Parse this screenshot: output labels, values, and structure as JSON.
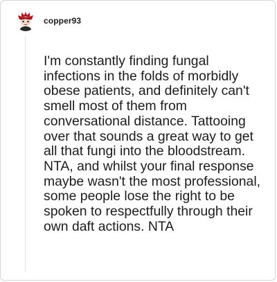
{
  "comment": {
    "username": "copper93",
    "avatar_icon": "cartoon-avatar-icon",
    "body": "I'm constantly finding fungal infections in the folds of morbidly obese patients, and definitely can't smell most of them from conversational distance. Tattooing over that sounds a great way to get all that fungi into the bloodstream. NTA, and whilst your final response maybe wasn't the most professional, some people lose the right to be spoken to respectfully through their own daft actions. NTA"
  }
}
